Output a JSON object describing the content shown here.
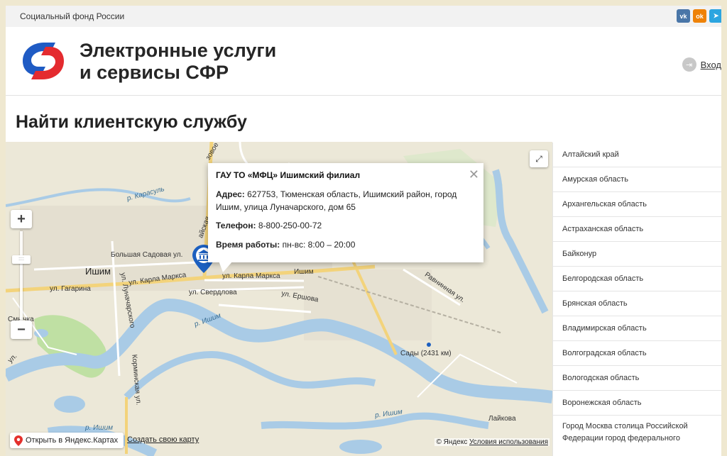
{
  "topbar": {
    "org_name": "Социальный фонд России",
    "social": [
      "vk",
      "ok",
      "telegram"
    ]
  },
  "header": {
    "brand_line1": "Электронные услуги",
    "brand_line2": "и сервисы СФР",
    "login_label": "Вход"
  },
  "page": {
    "title": "Найти клиентскую службу"
  },
  "popup": {
    "name": "ГАУ ТО «МФЦ» Ишимский филиал",
    "address_label": "Адрес:",
    "address_value": "627753, Тюменская область, Ишимский район, город Ишим, улица Луначарского, дом 65",
    "phone_label": "Телефон:",
    "phone_value": "8-800-250-00-72",
    "hours_label": "Время работы:",
    "hours_value": "пн-вс: 8:00 – 20:00"
  },
  "map": {
    "labels": {
      "ishim_city": "Ишим",
      "ishim_station": "Ишим",
      "karla_marksa_1": "ул. Карла Маркса",
      "karla_marksa_2": "ул. Карла Маркса",
      "gagarina": "ул. Гагарина",
      "lunacharskogo": "ул. Луначарского",
      "sverdlova": "ул. Свердлова",
      "ershova": "ул. Ершова",
      "bolshaya_sadovaya": "Большая Садовая ул.",
      "karasul": "р. Карасуль",
      "ishim_river_1": "р. Ишим",
      "ishim_river_2": "р. Ишим",
      "ishim_river_3": "р. Ишим",
      "ravninnaya": "Равнинная ул.",
      "sady": "Сады (2431 км)",
      "smychka": "Смычка",
      "korminskaya": "Корминская ул.",
      "laykova": "Лайкова",
      "ul": "ул.",
      "zovoe": "зовое",
      "ayskaya": "айская"
    },
    "open_yandex": "Открыть в Яндекс.Картах",
    "create_map": "Создать свою карту",
    "copyright_prefix": "© Яндекс",
    "terms": "Условия использования"
  },
  "regions": [
    "Алтайский край",
    "Амурская область",
    "Архангельская область",
    "Астраханская область",
    "Байконур",
    "Белгородская область",
    "Брянская область",
    "Владимирская область",
    "Волгоградская область",
    "Вологодская область",
    "Воронежская область",
    "Город Москва столица Российской Федерации город федерального"
  ],
  "colors": {
    "brand_blue": "#1f5bc4",
    "brand_red": "#e42b2f",
    "vk": "#4a76a8",
    "ok": "#ee8208",
    "telegram": "#2ca5e0"
  }
}
